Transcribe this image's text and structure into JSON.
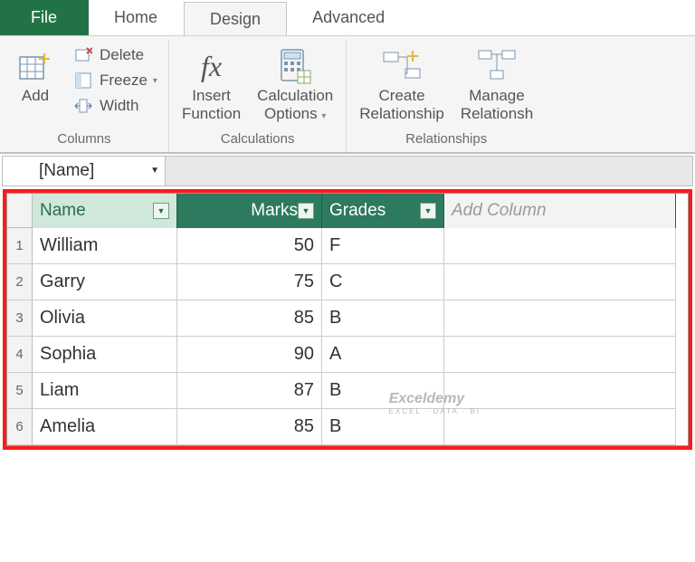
{
  "tabs": {
    "file": "File",
    "home": "Home",
    "design": "Design",
    "advanced": "Advanced"
  },
  "ribbon": {
    "columns": {
      "label": "Columns",
      "add": "Add",
      "delete": "Delete",
      "freeze": "Freeze",
      "width": "Width"
    },
    "calculations": {
      "label": "Calculations",
      "insert_fn_l1": "Insert",
      "insert_fn_l2": "Function",
      "calc_opt_l1": "Calculation",
      "calc_opt_l2": "Options"
    },
    "relationships": {
      "label": "Relationships",
      "create_l1": "Create",
      "create_l2": "Relationship",
      "manage_l1": "Manage",
      "manage_l2": "Relationsh"
    }
  },
  "formula_bar": {
    "namebox": "[Name]"
  },
  "table": {
    "columns": {
      "name": "Name",
      "marks": "Marks",
      "grades": "Grades",
      "add": "Add Column"
    },
    "rows": [
      {
        "n": "1",
        "name": "William",
        "marks": "50",
        "grade": "F"
      },
      {
        "n": "2",
        "name": "Garry",
        "marks": "75",
        "grade": "C"
      },
      {
        "n": "3",
        "name": "Olivia",
        "marks": "85",
        "grade": "B"
      },
      {
        "n": "4",
        "name": "Sophia",
        "marks": "90",
        "grade": "A"
      },
      {
        "n": "5",
        "name": "Liam",
        "marks": "87",
        "grade": "B"
      },
      {
        "n": "6",
        "name": "Amelia",
        "marks": "85",
        "grade": "B"
      }
    ]
  },
  "watermark": {
    "main": "Exceldemy",
    "sub": "EXCEL · DATA · BI"
  }
}
